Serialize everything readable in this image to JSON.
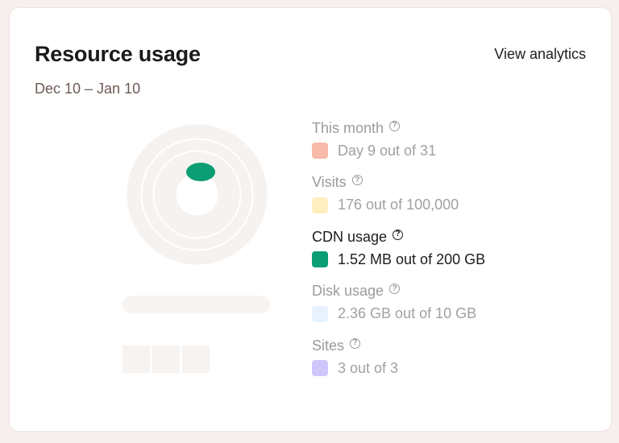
{
  "card": {
    "title": "Resource usage",
    "view_link": "View analytics",
    "date_range": "Dec 10 – Jan 10"
  },
  "legend": [
    {
      "label": "This month",
      "value": "Day 9 out of 31",
      "color": "#f9bba9",
      "active": false
    },
    {
      "label": "Visits",
      "value": "176 out of 100,000",
      "color": "#fdefc0",
      "active": false
    },
    {
      "label": "CDN usage",
      "value": "1.52 MB out of 200 GB",
      "color": "#0a9e72",
      "active": true
    },
    {
      "label": "Disk usage",
      "value": "2.36 GB out of 10 GB",
      "color": "#e6f2fd",
      "active": false
    },
    {
      "label": "Sites",
      "value": "3 out of 3",
      "color": "#cfc6fb",
      "active": false
    }
  ],
  "help_glyph": "?",
  "chart": {
    "ring_color": "#f5f2ef",
    "highlight_color": "#0a9e72",
    "cdn_fraction": 7.6e-06
  }
}
